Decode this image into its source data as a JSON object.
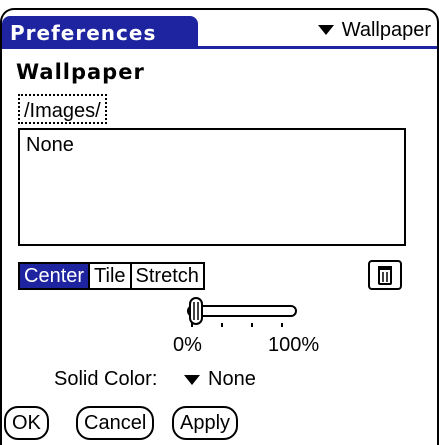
{
  "titlebar": {
    "title": "Preferences"
  },
  "category_selector": {
    "value": "Wallpaper",
    "icon": "triangle-down-icon"
  },
  "heading": "Wallpaper",
  "path_button": "/Images/",
  "file_list": {
    "items": [
      "None"
    ]
  },
  "modes": {
    "options": [
      "Center",
      "Tile",
      "Stretch"
    ],
    "selected": "Center"
  },
  "trash": {
    "icon": "trash-icon"
  },
  "slider": {
    "min_label": "0%",
    "max_label": "100%",
    "value_fraction": 0.0
  },
  "solid_color": {
    "label": "Solid Color:",
    "value": "None"
  },
  "buttons": {
    "ok": "OK",
    "cancel": "Cancel",
    "apply": "Apply"
  },
  "colors": {
    "accent": "#1e24a0",
    "background": "#ffffff"
  }
}
